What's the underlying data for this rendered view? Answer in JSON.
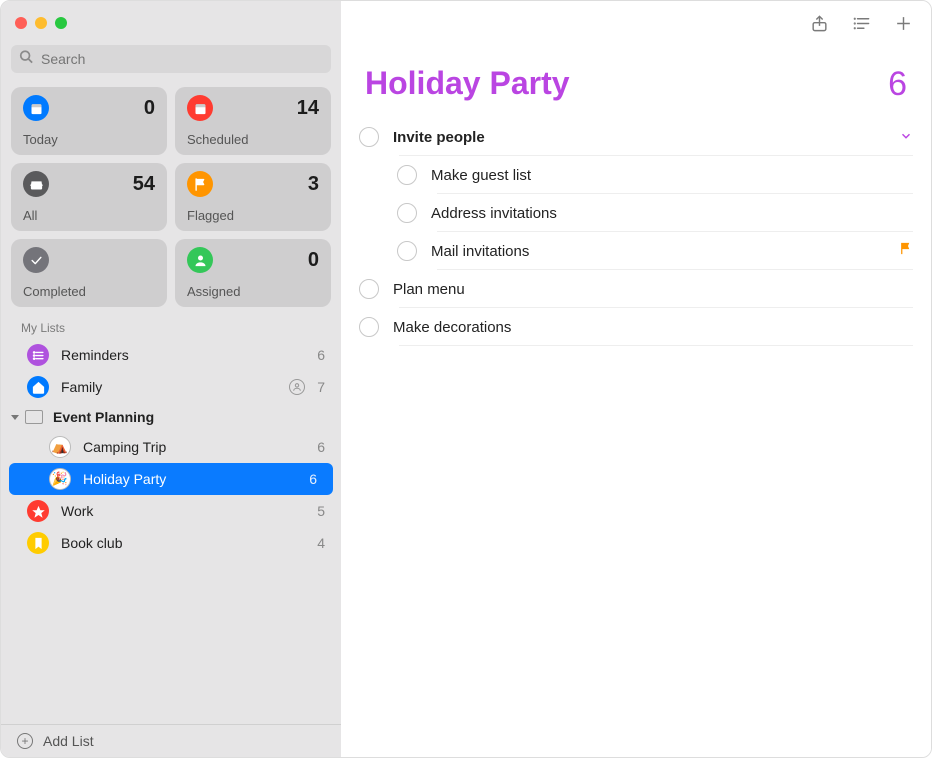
{
  "search": {
    "placeholder": "Search"
  },
  "smart": [
    {
      "key": "today",
      "label": "Today",
      "count": 0,
      "icon": "calendar",
      "bg": "bg-blue"
    },
    {
      "key": "scheduled",
      "label": "Scheduled",
      "count": 14,
      "icon": "calendar",
      "bg": "bg-red"
    },
    {
      "key": "all",
      "label": "All",
      "count": 54,
      "icon": "tray",
      "bg": "bg-grey"
    },
    {
      "key": "flagged",
      "label": "Flagged",
      "count": 3,
      "icon": "flag",
      "bg": "bg-orange"
    },
    {
      "key": "completed",
      "label": "Completed",
      "count": "",
      "icon": "check",
      "bg": "bg-greycheck"
    },
    {
      "key": "assigned",
      "label": "Assigned",
      "count": 0,
      "icon": "person",
      "bg": "bg-green"
    }
  ],
  "section_title": "My Lists",
  "lists": {
    "flat": [
      {
        "name": "Reminders",
        "count": 6,
        "bg": "bg-purple",
        "icon": "list",
        "shared": false
      },
      {
        "name": "Family",
        "count": 7,
        "bg": "bg-blue",
        "icon": "house",
        "shared": true
      }
    ],
    "group": {
      "name": "Event Planning",
      "children": [
        {
          "name": "Camping Trip",
          "count": 6,
          "emoji": "⛺",
          "selected": false
        },
        {
          "name": "Holiday Party",
          "count": 6,
          "emoji": "🎉",
          "selected": true
        }
      ]
    },
    "tail": [
      {
        "name": "Work",
        "count": 5,
        "bg": "bg-red",
        "icon": "star"
      },
      {
        "name": "Book club",
        "count": 4,
        "bg": "bg-yellow",
        "icon": "bookmark"
      }
    ]
  },
  "add_list_label": "Add List",
  "detail": {
    "title": "Holiday Party",
    "count": 6,
    "accent": "#ba45e2",
    "reminders": [
      {
        "title": "Invite people",
        "bold": true,
        "sub": false,
        "disclosure": true,
        "flagged": false
      },
      {
        "title": "Make guest list",
        "bold": false,
        "sub": true,
        "disclosure": false,
        "flagged": false
      },
      {
        "title": "Address invitations",
        "bold": false,
        "sub": true,
        "disclosure": false,
        "flagged": false
      },
      {
        "title": "Mail invitations",
        "bold": false,
        "sub": true,
        "disclosure": false,
        "flagged": true
      },
      {
        "title": "Plan menu",
        "bold": false,
        "sub": false,
        "disclosure": false,
        "flagged": false
      },
      {
        "title": "Make decorations",
        "bold": false,
        "sub": false,
        "disclosure": false,
        "flagged": false
      }
    ]
  }
}
